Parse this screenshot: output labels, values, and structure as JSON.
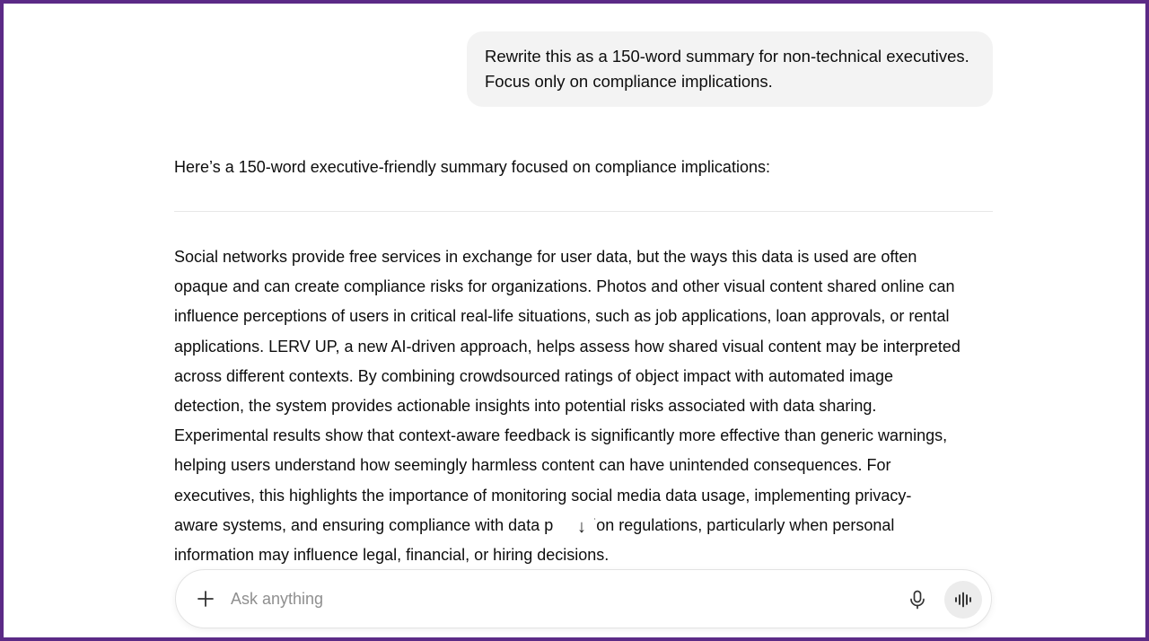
{
  "conversation": {
    "user_message": {
      "lines": [
        "Rewrite this as a 150-word summary for non-technical executives.",
        "Focus only on compliance implications."
      ]
    },
    "assistant": {
      "intro": "Here’s a 150-word executive-friendly summary focused on compliance implications:",
      "body_lines": [
        "Social networks provide free services in exchange for user data, but the ways this data is used are often",
        "opaque and can create compliance risks for organizations. Photos and other visual content shared online can",
        "influence perceptions of users in critical real-life situations, such as job applications, loan approvals, or rental",
        "applications. LERV UP, a new AI-driven approach, helps assess how shared visual content may be interpreted",
        "across different contexts. By combining crowdsourced ratings of object impact with automated image",
        "detection, the system provides actionable insights into potential risks associated with data sharing.",
        "Experimental results show that context-aware feedback is significantly more effective than generic warnings,",
        "helping users understand how seemingly harmless content can have unintended consequences. For",
        "executives, this highlights the importance of monitoring social media data usage, implementing privacy-",
        "aware systems, and ensuring compliance with data p      ction regulations, particularly when personal",
        "information may influence legal, financial, or hiring decisions."
      ]
    }
  },
  "scroll_button": {
    "icon": "arrow-down-icon",
    "glyph": "↓"
  },
  "composer": {
    "placeholder": "Ask anything",
    "value": "",
    "plus_icon": "plus-icon",
    "mic_icon": "microphone-icon",
    "voice_icon": "voice-mode-icon"
  },
  "colors": {
    "frame_border": "#5b2a86",
    "user_bubble_bg": "#f3f3f3",
    "text": "#0d0d0d",
    "placeholder": "#8f8f8f",
    "voice_button_bg": "#ececec"
  }
}
